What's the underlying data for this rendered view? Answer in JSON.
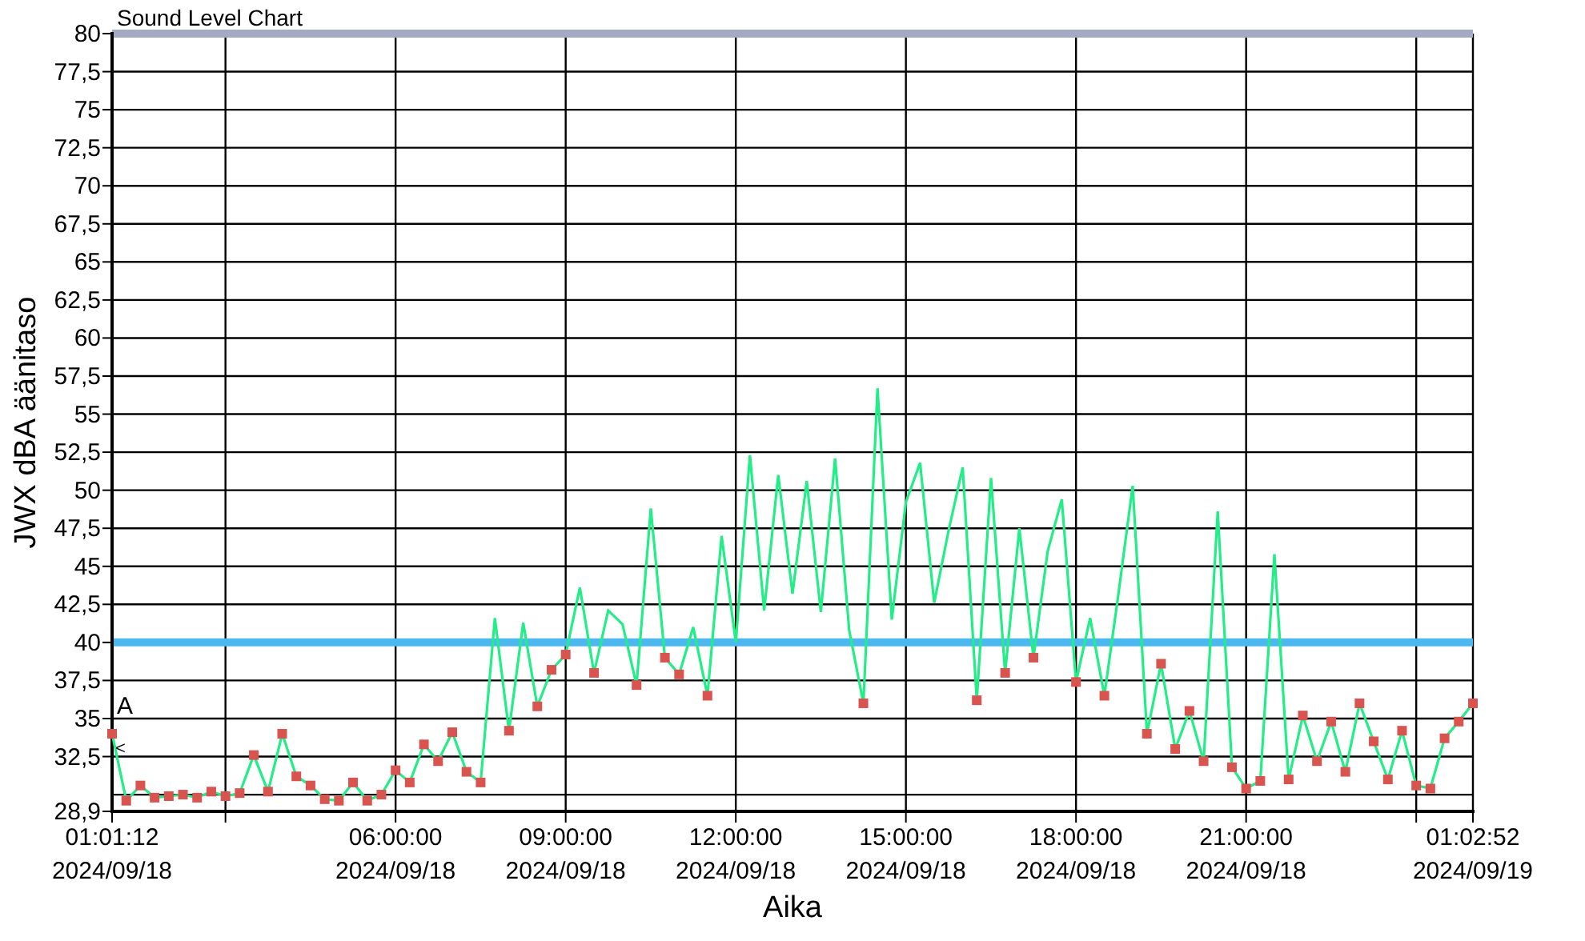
{
  "chart": {
    "chart_data": {
      "type": "line",
      "title": "Sound Level Chart",
      "xlabel": "Aika",
      "ylabel": "JWX dBA äänitaso",
      "categories": [
        "01:01:12\n2024/09/18",
        null,
        null,
        null,
        null,
        null,
        null,
        null,
        null,
        null,
        null,
        null,
        null,
        null,
        null,
        null,
        null,
        null,
        null,
        null,
        "06:00:00\n2024/09/18",
        null,
        null,
        null,
        null,
        null,
        null,
        null,
        null,
        null,
        null,
        null,
        "09:00:00\n2024/09/18",
        null,
        null,
        null,
        null,
        null,
        null,
        null,
        null,
        null,
        null,
        null,
        "12:00:00\n2024/09/18",
        null,
        null,
        null,
        null,
        null,
        null,
        null,
        null,
        null,
        null,
        null,
        "15:00:00\n2024/09/18",
        null,
        null,
        null,
        null,
        null,
        null,
        null,
        null,
        null,
        null,
        null,
        "18:00:00\n2024/09/18",
        null,
        null,
        null,
        null,
        null,
        null,
        null,
        null,
        null,
        null,
        null,
        "21:00:00\n2024/09/18",
        null,
        null,
        null,
        null,
        null,
        null,
        null,
        null,
        null,
        null,
        null,
        null,
        null,
        null,
        null,
        "01:02:52\n2024/09/19"
      ],
      "series": [
        {
          "color": "#22ee88",
          "values": [
            34.0,
            29.6,
            30.6,
            29.8,
            29.9,
            30.0,
            29.8,
            30.2,
            29.9,
            30.1,
            32.6,
            30.2,
            34.0,
            31.2,
            30.6,
            29.7,
            29.6,
            30.8,
            29.6,
            30.0,
            31.6,
            30.8,
            33.3,
            32.2,
            34.1,
            31.5,
            30.8,
            41.6,
            34.2,
            41.3,
            35.8,
            38.2,
            39.2,
            43.6,
            38.0,
            42.1,
            41.2,
            37.2,
            48.8,
            39.0,
            37.9,
            41.0,
            36.5,
            47.0,
            40.0,
            52.3,
            42.1,
            51.0,
            43.2,
            50.6,
            42.0,
            52.1,
            40.8,
            36.0,
            56.7,
            41.5,
            49.2,
            51.8,
            42.6,
            47.3,
            51.5,
            36.2,
            50.8,
            38.0,
            47.5,
            39.0,
            46.0,
            49.4,
            37.4,
            41.6,
            36.5,
            43.2,
            50.3,
            34.0,
            38.6,
            33.0,
            35.5,
            32.2,
            48.6,
            31.8,
            30.4,
            30.9,
            45.8,
            31.0,
            35.2,
            32.2,
            34.8,
            31.5,
            36.0,
            33.5,
            31.0,
            34.2,
            30.6,
            30.4,
            33.7,
            34.8,
            36.0
          ]
        }
      ],
      "ylim": [
        28.9,
        80
      ],
      "yticks": [
        {
          "value": 28.9,
          "label": "28,9"
        },
        {
          "value": 32.5,
          "label": "32,5"
        },
        {
          "value": 35,
          "label": "35"
        },
        {
          "value": 37.5,
          "label": "37,5"
        },
        {
          "value": 40,
          "label": "40"
        },
        {
          "value": 42.5,
          "label": "42,5"
        },
        {
          "value": 45,
          "label": "45"
        },
        {
          "value": 47.5,
          "label": "47,5"
        },
        {
          "value": 50,
          "label": "50"
        },
        {
          "value": 52.5,
          "label": "52,5"
        },
        {
          "value": 55,
          "label": "55"
        },
        {
          "value": 57.5,
          "label": "57,5"
        },
        {
          "value": 60,
          "label": "60"
        },
        {
          "value": 62.5,
          "label": "62,5"
        },
        {
          "value": 65,
          "label": "65"
        },
        {
          "value": 67.5,
          "label": "67,5"
        },
        {
          "value": 70,
          "label": "70"
        },
        {
          "value": 72.5,
          "label": "72,5"
        },
        {
          "value": 75,
          "label": "75"
        },
        {
          "value": 77.5,
          "label": "77,5"
        },
        {
          "value": 80,
          "label": "80"
        }
      ],
      "grid": true,
      "ref_lines": [
        {
          "axis": "y",
          "value": 40,
          "color": "#4db8f0"
        },
        {
          "axis": "y",
          "value": 80,
          "color": "#a3abc4"
        }
      ],
      "annotations": [
        "A",
        "<"
      ]
    }
  }
}
